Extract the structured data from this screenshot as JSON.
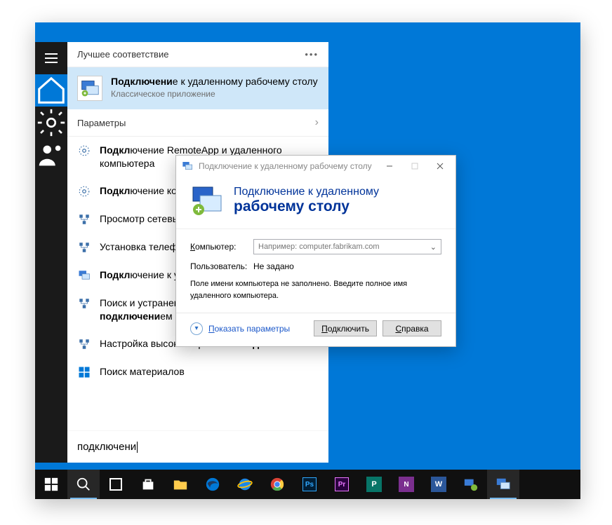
{
  "start": {
    "best_header": "Лучшее соответствие",
    "best_title_html": "<b>Подключени</b>е к удаленному рабочему столу",
    "best_sub": "Классическое приложение",
    "params_header": "Параметры",
    "items": [
      "<b>Подкл</b>ючение RemoteApp и удаленного компьютера",
      "<b>Подкл</b>ючение компьютера к домену",
      "Просмотр сетевых <b>подключени</b>й",
      "Установка телефонного <b>подключени</b>я",
      "<b>Подкл</b>ючение к удаленному рабочему столу",
      "Поиск и устранение проблем с сетью и <b>подключени</b>ем",
      "Настройка высокоскоростного <b>подключени</b>я"
    ],
    "store_item": "Поиск материалов",
    "search_value": "подключени"
  },
  "dialog": {
    "title": "Подключение к удаленному рабочему столу",
    "banner1": "Подключение к удаленному",
    "banner2": "рабочему столу",
    "computer_label": "Компьютер:",
    "computer_hint": "Например: computer.fabrikam.com",
    "user_label": "Пользователь:",
    "user_value": "Не задано",
    "msg": "Поле имени компьютера не заполнено. Введите полное имя удаленного компьютера.",
    "show_params": "Показать параметры",
    "connect": "Подключить",
    "help": "Справка"
  }
}
